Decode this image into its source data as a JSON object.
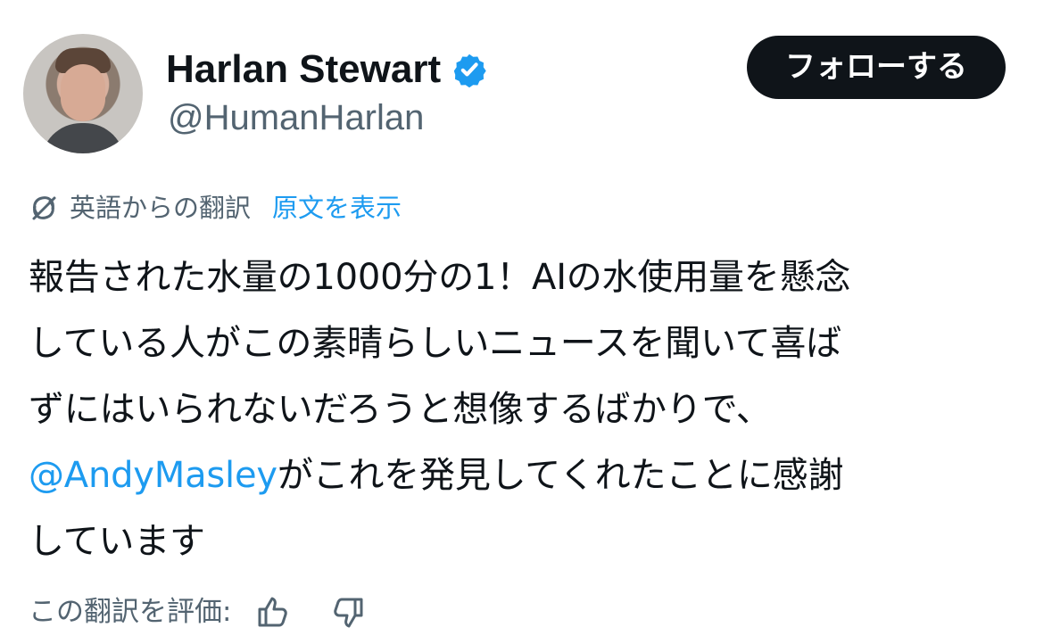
{
  "author": {
    "display_name": "Harlan Stewart",
    "handle": "@HumanHarlan",
    "avatar_icon": "profile-photo",
    "verified_icon": "verified-badge-icon"
  },
  "actions": {
    "follow_label": "フォローする"
  },
  "translation": {
    "label": "英語からの翻訳",
    "show_original_label": "原文を表示",
    "icon": "translate-icon"
  },
  "tweet": {
    "lines": [
      "報告された水量の1000分の1！AIの水使用量を懸念",
      "している人がこの素晴らしいニュースを聞いて喜ば",
      "ずにはいられないだろうと想像するばかりで、",
      "がこれを発見してくれたことに感謝",
      "しています"
    ],
    "mention": "@AndyMasley"
  },
  "rating": {
    "label": "この翻訳を評価:",
    "thumbs_up_icon": "thumbs-up-icon",
    "thumbs_down_icon": "thumbs-down-icon"
  },
  "colors": {
    "text": "#0f1419",
    "secondary_text": "#536471",
    "link": "#1d9bf0",
    "follow_button_bg": "#0f1419",
    "follow_button_text": "#ffffff",
    "verified": "#1d9bf0"
  }
}
